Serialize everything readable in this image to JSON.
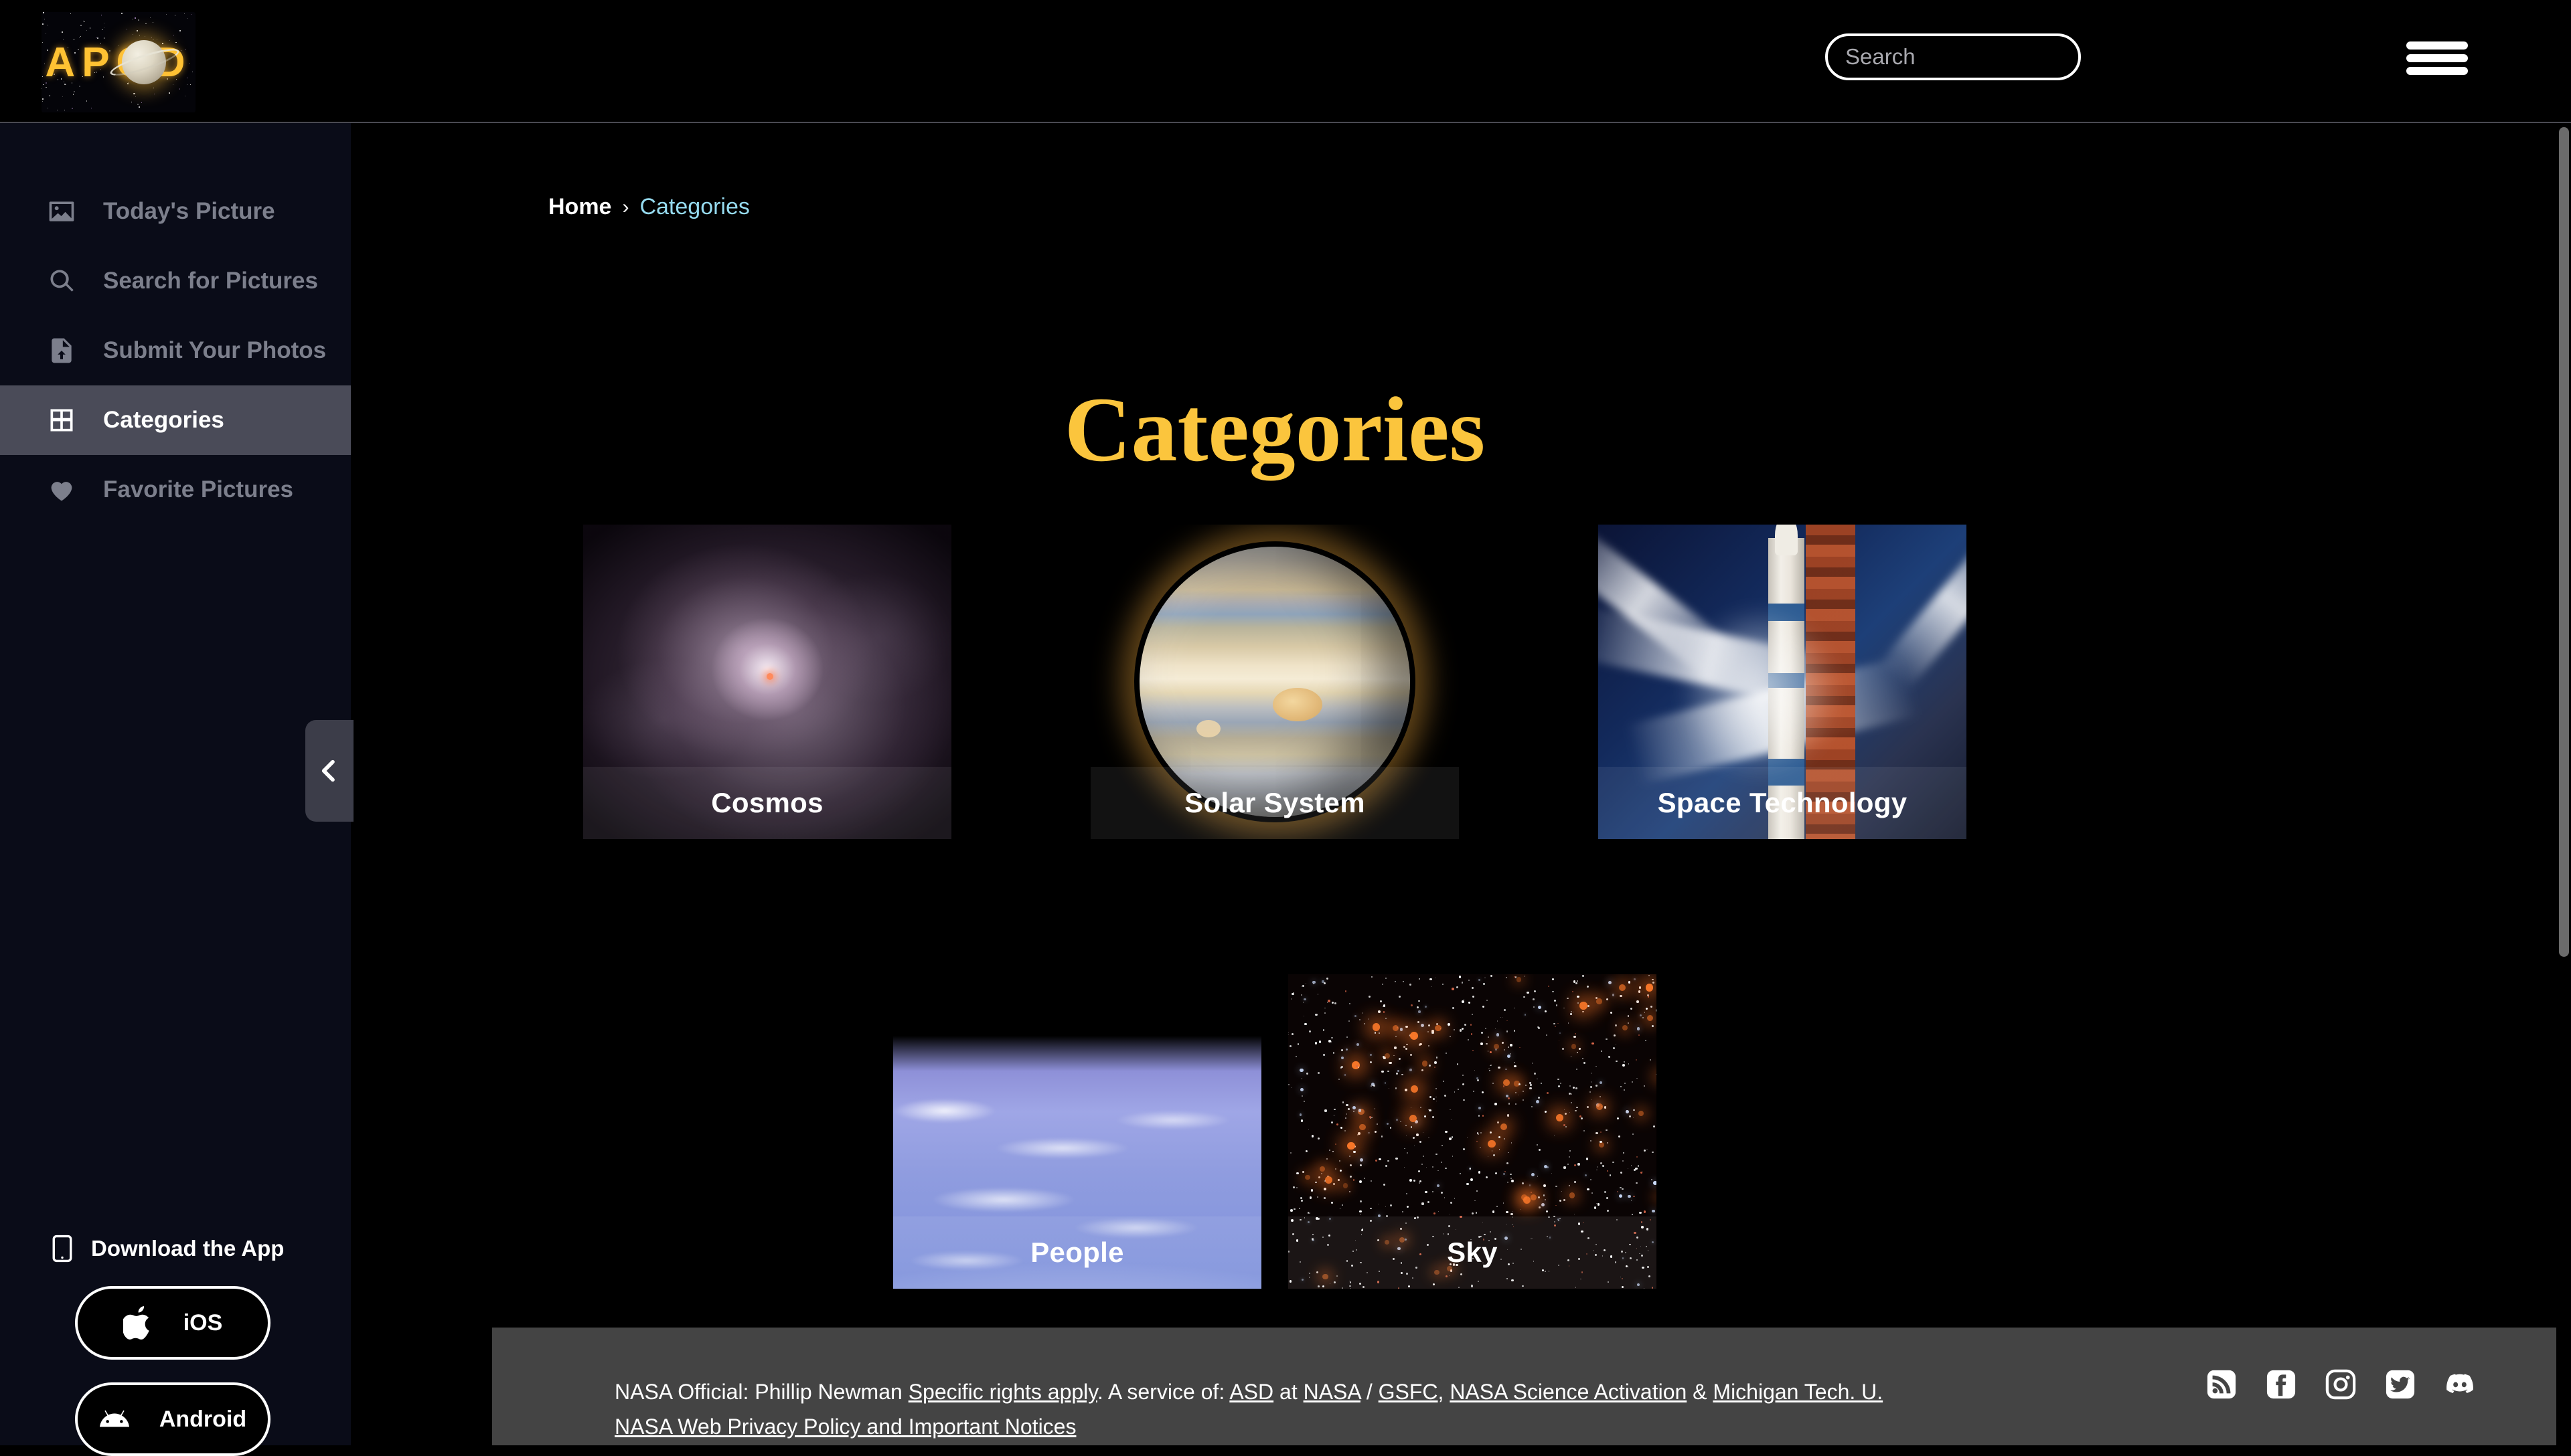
{
  "header": {
    "logo_text": "APOD",
    "logo_alt": "apod-saturn-logo",
    "search": {
      "placeholder": "Search",
      "value": "",
      "icon": "search-icon"
    },
    "menu_icon": "hamburger-menu-icon"
  },
  "sidebar": {
    "items": [
      {
        "label": "Today's Picture",
        "icon": "image-icon",
        "active": false
      },
      {
        "label": "Search for Pictures",
        "icon": "search-icon",
        "active": false
      },
      {
        "label": "Submit Your Photos",
        "icon": "file-upload-icon",
        "active": false
      },
      {
        "label": "Categories",
        "icon": "grid-icon",
        "active": true
      },
      {
        "label": "Favorite Pictures",
        "icon": "heart-icon",
        "active": false
      }
    ],
    "collapse_icon": "chevron-left-icon",
    "download": {
      "title": "Download the App",
      "title_icon": "mobile-phone-icon",
      "buttons": [
        {
          "label": "iOS",
          "icon": "apple-icon"
        },
        {
          "label": "Android",
          "icon": "android-icon"
        }
      ]
    }
  },
  "main": {
    "breadcrumb": {
      "home": "Home",
      "separator": "›",
      "current": "Categories"
    },
    "title": "Categories",
    "categories": [
      {
        "label": "Cosmos",
        "art": "nebula"
      },
      {
        "label": "Solar System",
        "art": "jupiter"
      },
      {
        "label": "Space Technology",
        "art": "rocket-launch"
      },
      {
        "label": "People",
        "art": "astronaut-over-earth"
      },
      {
        "label": "Sky",
        "art": "star-field"
      }
    ]
  },
  "footer": {
    "line1_prefix": "NASA Official: Phillip Newman ",
    "link_rights": "Specific rights apply",
    "line1_mid": ". A service of: ",
    "link_asd": "ASD",
    "line1_at": " at ",
    "link_nasa": "NASA",
    "line1_slash": " / ",
    "link_gsfc": "GSFC",
    "line1_comma": ", ",
    "link_sciact": "NASA Science Activation",
    "line1_amp": " & ",
    "link_mtu": "Michigan Tech. U.",
    "line2": "NASA Web Privacy Policy and Important Notices",
    "socials": [
      "rss-icon",
      "facebook-icon",
      "instagram-icon",
      "twitter-icon",
      "discord-icon"
    ]
  },
  "colors": {
    "accent_gold": "#FBC53D",
    "breadcrumb_link": "#96dbf0",
    "sidebar_bg": "#0a0c18",
    "active_nav_bg": "#4a4b58",
    "footer_bg": "#444444"
  }
}
